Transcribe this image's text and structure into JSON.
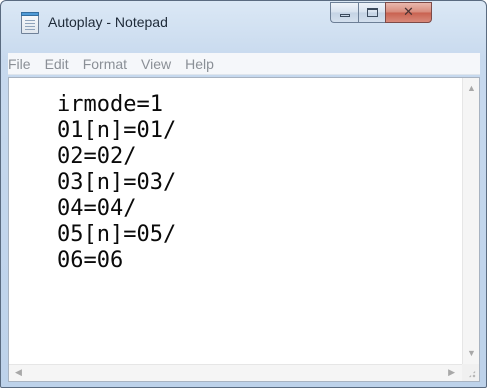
{
  "window": {
    "title": "Autoplay - Notepad",
    "icon": "notepad-icon"
  },
  "caption_buttons": {
    "minimize_icon": "minimize-icon",
    "maximize_icon": "maximize-icon",
    "close_icon": "close-icon",
    "close_glyph": "✕"
  },
  "menu": {
    "items": [
      {
        "label": "File"
      },
      {
        "label": "Edit"
      },
      {
        "label": "Format"
      },
      {
        "label": "View"
      },
      {
        "label": "Help"
      }
    ]
  },
  "editor": {
    "content": "irmode=1\n01[n]=01/\n02=02/\n03[n]=03/\n04=04/\n05[n]=05/\n06=06"
  },
  "scrollbars": {
    "up_arrow": "▲",
    "down_arrow": "▼",
    "left_arrow": "◀",
    "right_arrow": "▶"
  }
}
